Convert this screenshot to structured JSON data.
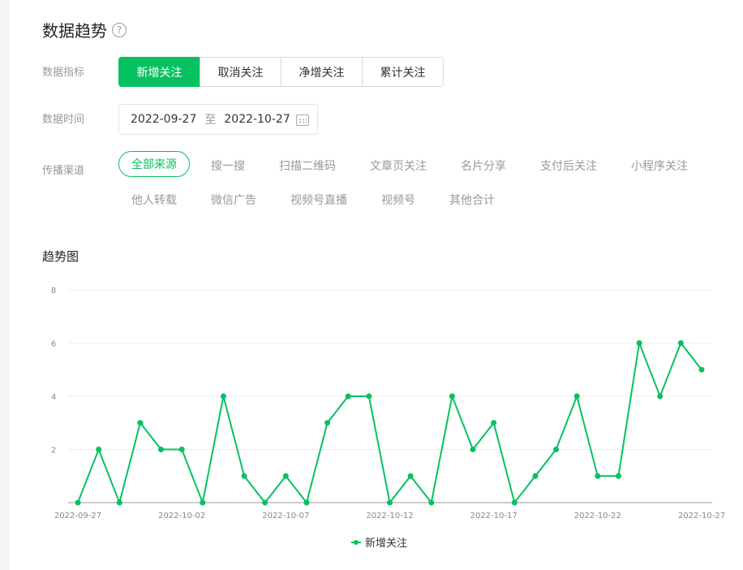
{
  "section": {
    "title": "数据趋势",
    "help_glyph": "?"
  },
  "metric": {
    "label": "数据指标",
    "options": [
      "新增关注",
      "取消关注",
      "净增关注",
      "累计关注"
    ],
    "selected": "新增关注"
  },
  "date": {
    "label": "数据时间",
    "start": "2022-09-27",
    "sep": "至",
    "end": "2022-10-27"
  },
  "channel": {
    "label": "传播渠道",
    "selected": "全部来源",
    "row1": [
      "全部来源",
      "搜一搜",
      "扫描二维码",
      "文章页关注",
      "名片分享",
      "支付后关注",
      "小程序关注"
    ],
    "row2": [
      "他人转载",
      "微信广告",
      "视频号直播",
      "视频号",
      "其他合计"
    ]
  },
  "chart_title": "趋势图",
  "legend_label": "新增关注",
  "colors": {
    "accent": "#07c160"
  },
  "chart_data": {
    "type": "line",
    "x": [
      "2022-09-27",
      "2022-09-28",
      "2022-09-29",
      "2022-09-30",
      "2022-10-01",
      "2022-10-02",
      "2022-10-03",
      "2022-10-04",
      "2022-10-05",
      "2022-10-06",
      "2022-10-07",
      "2022-10-08",
      "2022-10-09",
      "2022-10-10",
      "2022-10-11",
      "2022-10-12",
      "2022-10-13",
      "2022-10-14",
      "2022-10-15",
      "2022-10-16",
      "2022-10-17",
      "2022-10-18",
      "2022-10-19",
      "2022-10-20",
      "2022-10-21",
      "2022-10-22",
      "2022-10-23",
      "2022-10-24",
      "2022-10-25",
      "2022-10-26",
      "2022-10-27"
    ],
    "series": [
      {
        "name": "新增关注",
        "values": [
          0,
          2,
          0,
          3,
          2,
          2,
          0,
          4,
          1,
          0,
          1,
          0,
          3,
          4,
          4,
          0,
          1,
          0,
          4,
          2,
          3,
          0,
          1,
          2,
          4,
          1,
          1,
          6,
          4,
          6,
          5
        ]
      }
    ],
    "xtick_labels": [
      "2022-09-27",
      "2022-10-02",
      "2022-10-07",
      "2022-10-12",
      "2022-10-17",
      "2022-10-22",
      "2022-10-27"
    ],
    "yticks": [
      2,
      4,
      6,
      8
    ],
    "ylim": [
      0,
      8
    ],
    "grid": true,
    "legend_position": "bottom-center"
  }
}
